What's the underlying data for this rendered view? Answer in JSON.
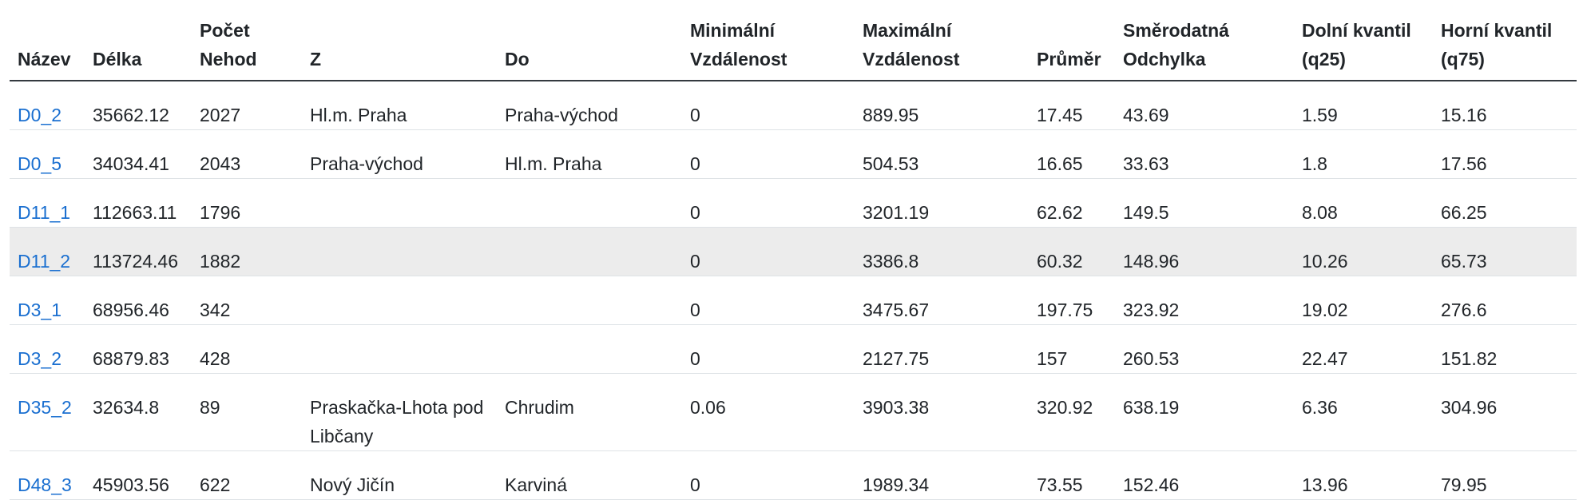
{
  "table": {
    "headers": [
      "Název",
      "Délka",
      "Počet Nehod",
      "Z",
      "Do",
      "Minimální Vzdálenost",
      "Maximální Vzdálenost",
      "Průměr",
      "Směrodatná Odchylka",
      "Dolní kvantil (q25)",
      "Horní kvantil (q75)"
    ],
    "rows": [
      [
        "D0_2",
        "35662.12",
        "2027",
        "Hl.m. Praha",
        "Praha-východ",
        "0",
        "889.95",
        "17.45",
        "43.69",
        "1.59",
        "15.16"
      ],
      [
        "D0_5",
        "34034.41",
        "2043",
        "Praha-východ",
        "Hl.m. Praha",
        "0",
        "504.53",
        "16.65",
        "33.63",
        "1.8",
        "17.56"
      ],
      [
        "D11_1",
        "112663.11",
        "1796",
        "",
        "",
        "0",
        "3201.19",
        "62.62",
        "149.5",
        "8.08",
        "66.25"
      ],
      [
        "D11_2",
        "113724.46",
        "1882",
        "",
        "",
        "0",
        "3386.8",
        "60.32",
        "148.96",
        "10.26",
        "65.73"
      ],
      [
        "D3_1",
        "68956.46",
        "342",
        "",
        "",
        "0",
        "3475.67",
        "197.75",
        "323.92",
        "19.02",
        "276.6"
      ],
      [
        "D3_2",
        "68879.83",
        "428",
        "",
        "",
        "0",
        "2127.75",
        "157",
        "260.53",
        "22.47",
        "151.82"
      ],
      [
        "D35_2",
        "32634.8",
        "89",
        "Praskačka-Lhota pod Libčany",
        "Chrudim",
        "0.06",
        "3903.38",
        "320.92",
        "638.19",
        "6.36",
        "304.96"
      ],
      [
        "D48_3",
        "45903.56",
        "622",
        "Nový Jičín",
        "Karviná",
        "0",
        "1989.34",
        "73.55",
        "152.46",
        "13.96",
        "79.95"
      ]
    ]
  },
  "colors": {
    "link": "#1a6fd0",
    "hover_row": "#ececec",
    "header_border": "#343a40",
    "row_border": "#dee2e6"
  }
}
